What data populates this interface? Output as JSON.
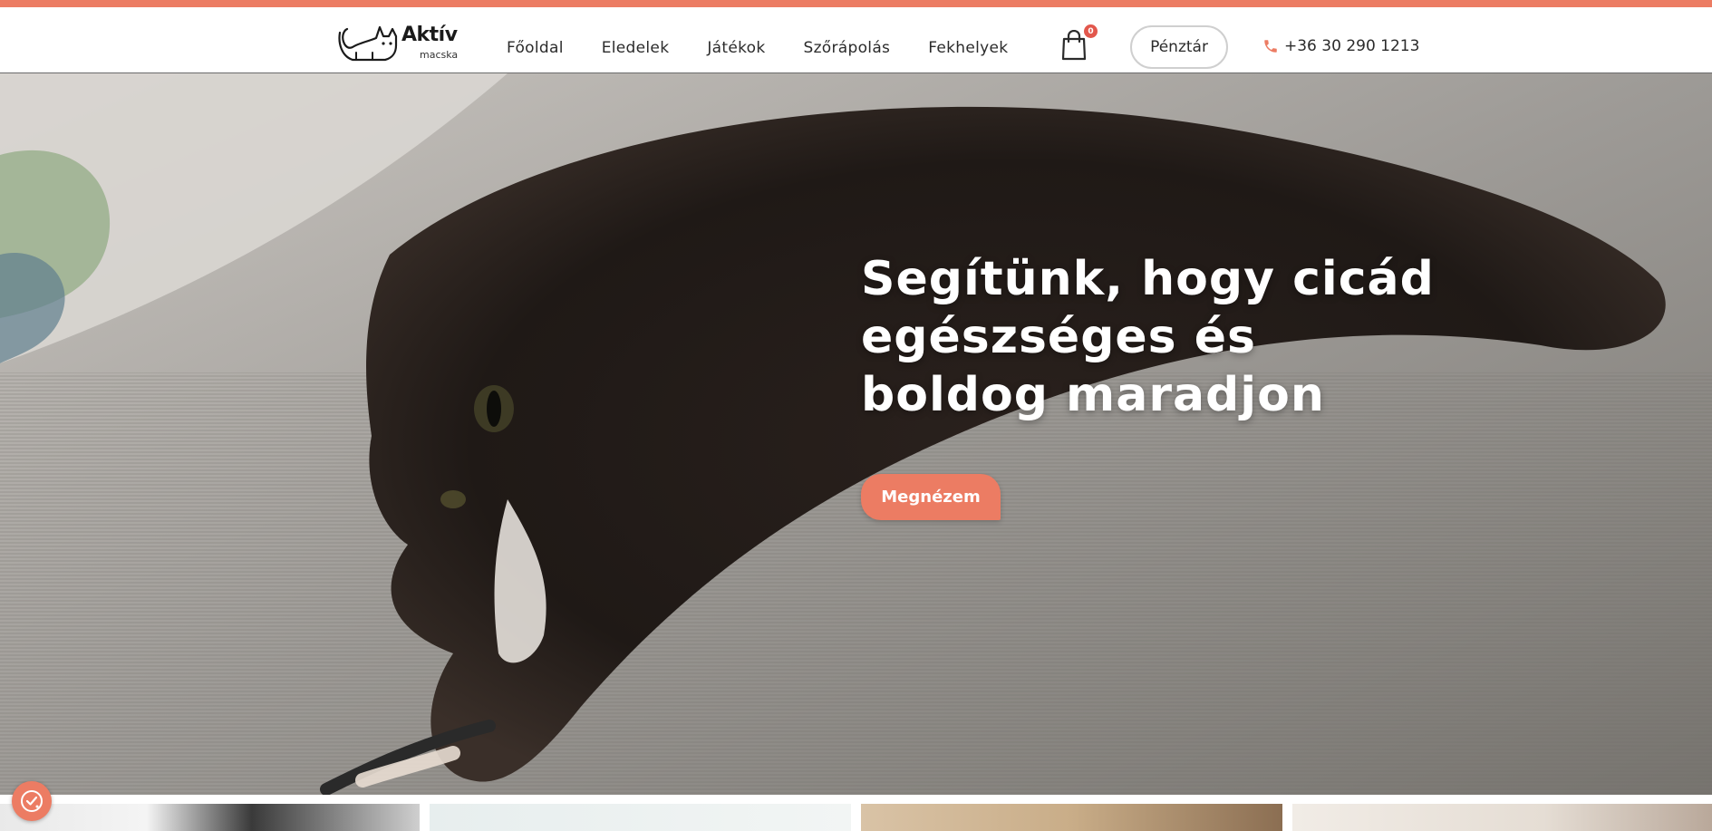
{
  "brand": {
    "name": "Aktív",
    "sub": "macska"
  },
  "nav": {
    "items": [
      {
        "label": "Főoldal",
        "active": true
      },
      {
        "label": "Eledelek",
        "active": false
      },
      {
        "label": "Játékok",
        "active": false
      },
      {
        "label": "Szőrápolás",
        "active": false
      },
      {
        "label": "Fekhelyek",
        "active": false
      }
    ]
  },
  "cart": {
    "count": "0",
    "icon": "shopping-bag-icon"
  },
  "checkout": {
    "label": "Pénztár"
  },
  "phone": {
    "label": "+36 30 290 1213",
    "icon": "phone-icon"
  },
  "hero": {
    "title": "Segítünk, hogy cicád egészséges és boldog maradjon",
    "cta_label": "Megnézem"
  },
  "cookie": {
    "icon": "cookie-consent-icon"
  },
  "colors": {
    "accent": "#ec7c63",
    "badge": "#e2574c",
    "text": "#2b2b2b",
    "white": "#ffffff"
  }
}
